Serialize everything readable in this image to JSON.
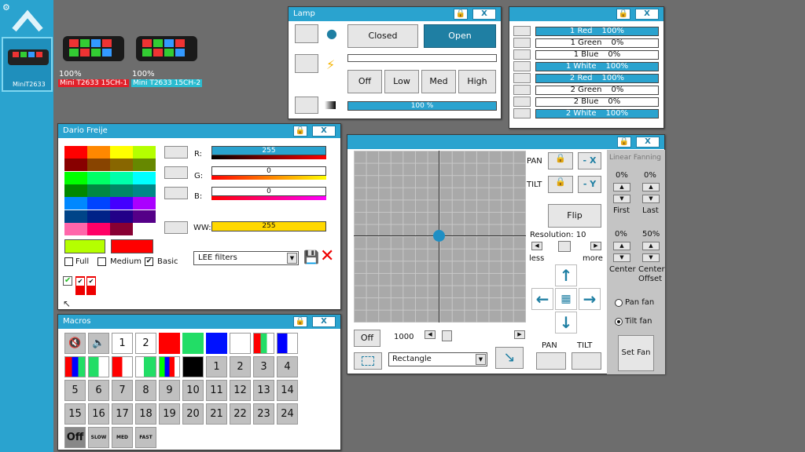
{
  "sidebar": {
    "home": "home-icon"
  },
  "fixtures": [
    {
      "pct": "",
      "label": "MiniT2633",
      "selected": true
    },
    {
      "pct": "100%",
      "label": "Mini T2633 15CH-1",
      "color": "#e2202a"
    },
    {
      "pct": "100%",
      "label": "Mini T2633 15CH-2",
      "color": "#2bbcd0"
    }
  ],
  "lamp": {
    "title": "Lamp",
    "closed": "Closed",
    "open": "Open",
    "off": "Off",
    "low": "Low",
    "med": "Med",
    "high": "High",
    "intensity": "100 %"
  },
  "channels": {
    "rows": [
      {
        "label": "1 Red",
        "value": "100%",
        "active": true
      },
      {
        "label": "1 Green",
        "value": "0%",
        "active": false
      },
      {
        "label": "1 Blue",
        "value": "0%",
        "active": false
      },
      {
        "label": "1 White",
        "value": "100%",
        "active": true
      },
      {
        "label": "2 Red",
        "value": "100%",
        "active": true
      },
      {
        "label": "2 Green",
        "value": "0%",
        "active": false
      },
      {
        "label": "2 Blue",
        "value": "0%",
        "active": false
      },
      {
        "label": "2 White",
        "value": "100%",
        "active": true
      }
    ]
  },
  "color": {
    "title": "Dario Freije",
    "r_label": "R:",
    "g_label": "G:",
    "b_label": "B:",
    "ww_label": "WW:",
    "r": "255",
    "g": "0",
    "b": "0",
    "ww": "255",
    "full": "Full",
    "medium": "Medium",
    "basic": "Basic",
    "filter": "LEE filters"
  },
  "macros": {
    "title": "Macros",
    "numbers": [
      "1",
      "2",
      "3",
      "4",
      "5",
      "6",
      "7",
      "8",
      "9",
      "10",
      "11",
      "12",
      "13",
      "14",
      "15",
      "16",
      "17",
      "18",
      "19",
      "20",
      "21",
      "22",
      "23",
      "24"
    ],
    "off": "Off",
    "slow": "SLOW",
    "med": "MED",
    "fast": "FAST"
  },
  "pantilt": {
    "pan": "PAN",
    "tilt": "TILT",
    "minus_x": "- X",
    "minus_y": "- Y",
    "flip": "Flip",
    "resolution": "Resolution: 10",
    "less": "less",
    "more": "more",
    "off": "Off",
    "speed": "1000",
    "shape": "Rectangle",
    "pan_btn": "PAN",
    "tilt_btn": "TILT"
  },
  "fanning": {
    "title": "Linear Fanning",
    "first_pct": "0%",
    "last_pct": "0%",
    "first": "First",
    "last": "Last",
    "center_pct": "0%",
    "offset_pct": "50%",
    "center": "Center",
    "center_offset": "Center Offset",
    "pan_fan": "Pan fan",
    "tilt_fan": "Tilt fan",
    "set_fan": "Set Fan"
  }
}
